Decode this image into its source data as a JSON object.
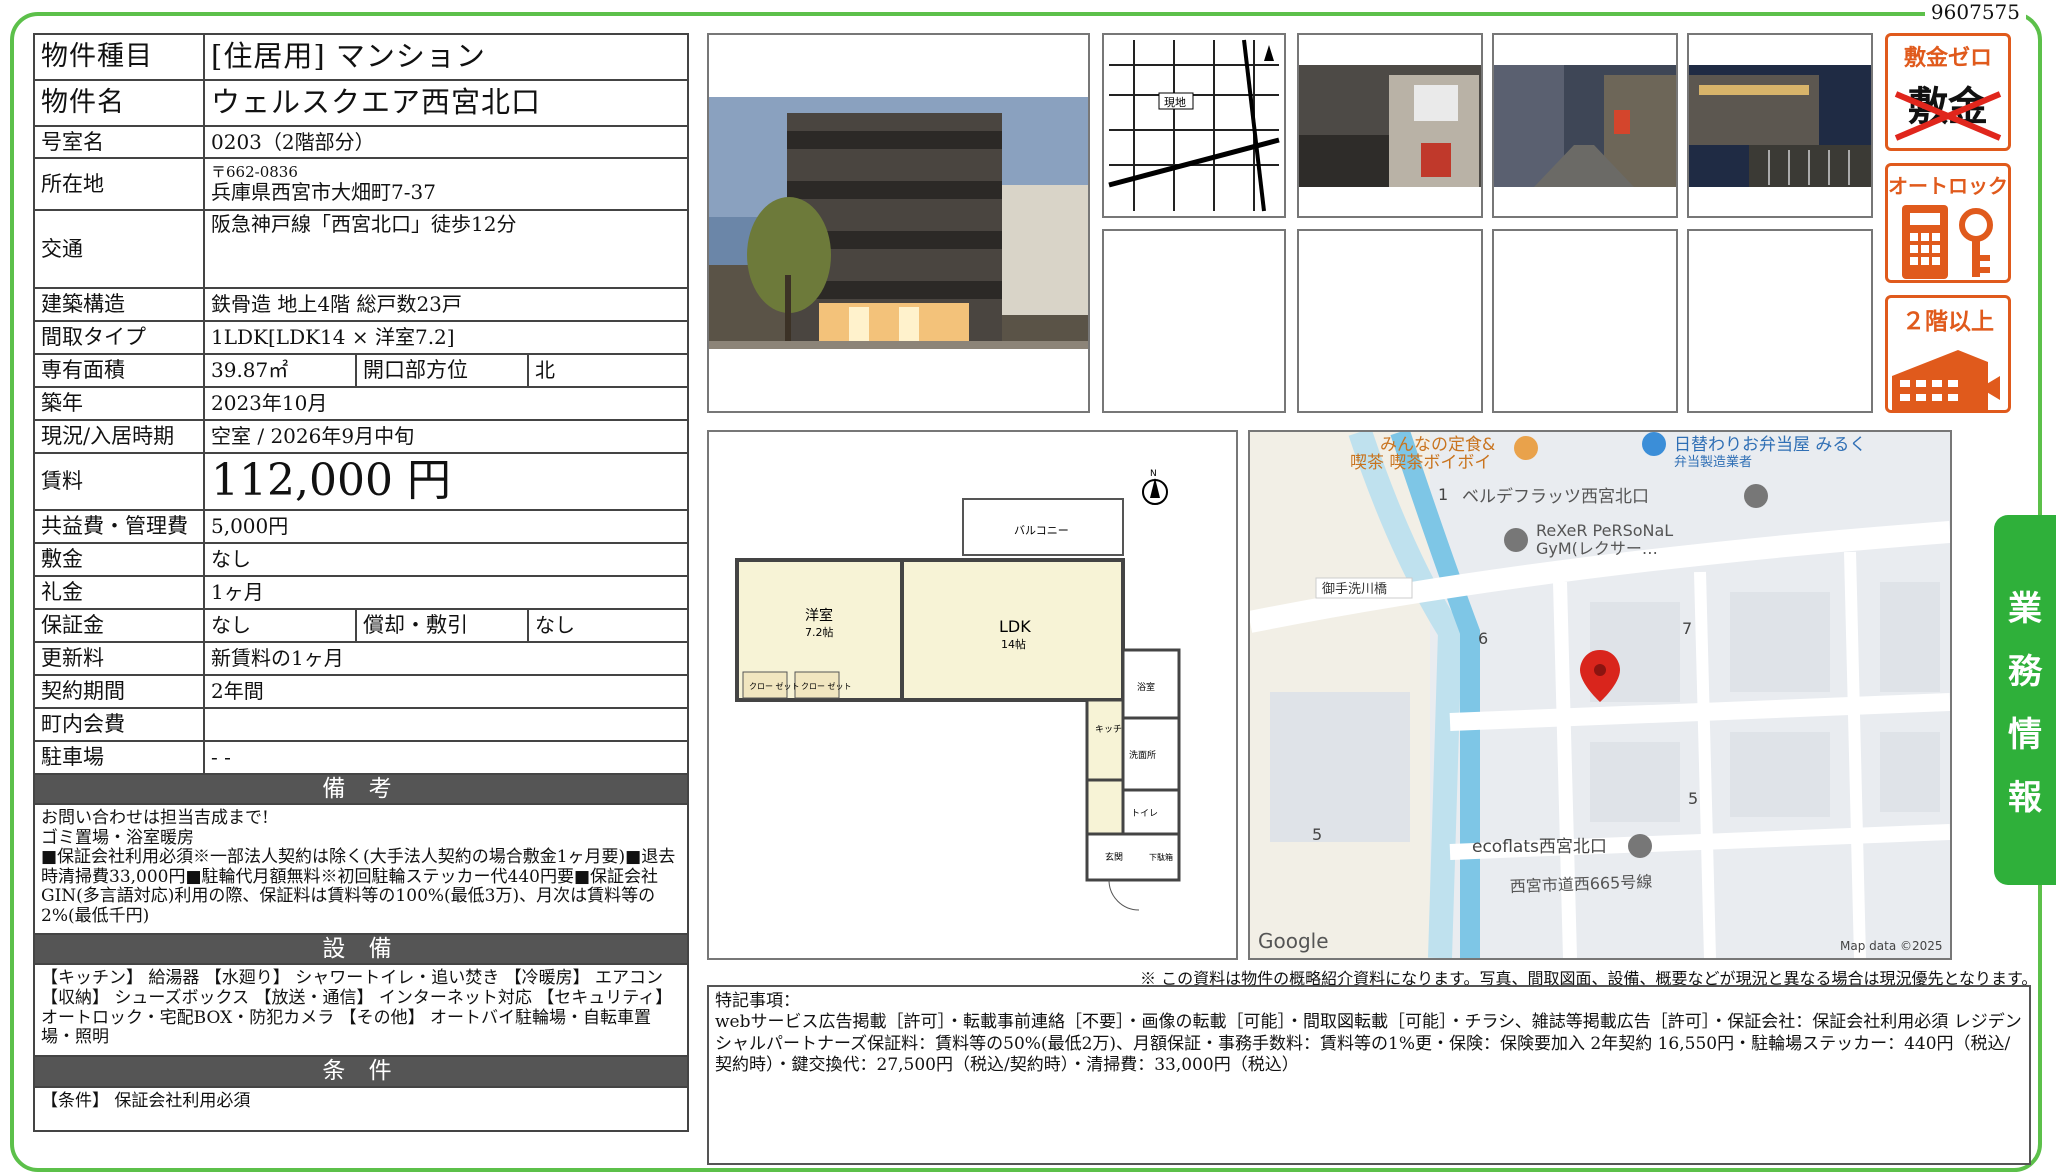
{
  "doc_id": "9607575",
  "table": {
    "kind_label": "物件種目",
    "kind_value": "[住居用] マンション",
    "name_label": "物件名",
    "name_value": "ウェルスクエア西宮北口",
    "room_label": "号室名",
    "room_value": "0203（2階部分）",
    "addr_label": "所在地",
    "zip": "〒662-0836",
    "addr_value": "兵庫県西宮市大畑町7-37",
    "access_label": "交通",
    "access_value": "阪急神戸線「西宮北口」徒歩12分",
    "struct_label": "建築構造",
    "struct_value": "鉄骨造 地上4階 総戸数23戸",
    "layout_label": "間取タイプ",
    "layout_value": "1LDK[LDK14 × 洋室7.2]",
    "area_label": "専有面積",
    "area_value": "39.87㎡",
    "dir_label": "開口部方位",
    "dir_value": "北",
    "built_label": "築年",
    "built_value": "2023年10月",
    "status_label": "現況/入居時期",
    "status_value": "空室 / 2026年9月中旬",
    "rent_label": "賃料",
    "rent_value": "112,000 円",
    "fee_label": "共益費・管理費",
    "fee_value": "5,000円",
    "deposit_label": "敷金",
    "deposit_value": "なし",
    "key_label": "礼金",
    "key_value": "1ヶ月",
    "guar_label": "保証金",
    "guar_value": "なし",
    "amort_label": "償却・敷引",
    "amort_value": "なし",
    "renew_label": "更新料",
    "renew_value": "新賃料の1ヶ月",
    "term_label": "契約期間",
    "term_value": "2年間",
    "town_label": "町内会費",
    "town_value": "",
    "parking_label": "駐車場",
    "parking_value": "- -",
    "notes_header": "備 考",
    "notes": [
      "お問い合わせは担当吉成まで!",
      "ゴミ置場・浴室暖房",
      "■保証会社利用必須※一部法人契約は除く(大手法人契約の場合敷金1ヶ月要)■退去時清掃費33,000円■駐輪代月額無料※初回駐輪ステッカー代440円要■保証会社GIN(多言語対応)利用の際、保証料は賃料等の100%(最低3万)、月次は賃料等の2%(最低千円)"
    ],
    "equip_header": "設 備",
    "equip": "【キッチン】 給湯器 【水廻り】 シャワートイレ・追い焚き 【冷暖房】 エアコン 【収納】 シューズボックス 【放送・通信】 インターネット対応 【セキュリティ】 オートロック・宅配BOX・防犯カメラ 【その他】 オートバイ駐輪場・自転車置場・照明",
    "cond_header": "条 件",
    "cond": "【条件】 保証会社利用必須"
  },
  "icons": {
    "zero_deposit": "敷金ゼロ",
    "zero_deposit_strike": "敷金",
    "autolock": "オートロック",
    "floor2": "２階以上"
  },
  "tab_chars": [
    "業",
    "務",
    "情",
    "報"
  ],
  "floorplan": {
    "balcony": "バルコニー",
    "western": "洋室",
    "western_size": "7.2帖",
    "ldk": "LDK",
    "ldk_size": "14帖",
    "closet": "クロー\nゼット",
    "kitchen": "キッチン",
    "bath": "浴室",
    "wash": "洗面所",
    "toilet": "トイレ",
    "entrance": "玄関",
    "shoe": "下駄箱",
    "north": "N"
  },
  "map": {
    "poi1": "みんなの定食&",
    "poi1b": "喫茶 喫茶ボイボイ",
    "poi2": "日替わりお弁当屋 みるく",
    "poi2b": "弁当製造業者",
    "poi3": "ベルデフラッツ西宮北口",
    "poi4": "ReXeR PeRSoNaL",
    "poi4b": "GyM(レクサー…",
    "bridge": "御手洗川橋",
    "poi5": "ecoflats西宮北口",
    "road": "西宮市道西665号線",
    "n1": "1",
    "n6": "6",
    "n7": "7",
    "n5a": "5",
    "n5b": "5",
    "google": "Google",
    "mapdata": "Map data ©2025"
  },
  "disclaimer": "※ この資料は物件の概略紹介資料になります。写真、間取図面、設備、概要などが現況と異なる場合は現況優先となります。",
  "remarks_title": "特記事項：",
  "remarks": "webサービス広告掲載［許可］・転載事前連絡［不要］・画像の転載［可能］・間取図転載［可能］・チラシ、雑誌等掲載広告［許可］・保証会社：保証会社利用必須 レジデンシャルパートナーズ保証料：賃料等の50%(最低2万)、月額保証・事務手数料：賃料等の1%更・保険：保険要加入 2年契約 16,550円・駐輪場ステッカー：440円（税込/契約時）・鍵交換代：27,500円（税込/契約時）・清掃費：33,000円（税込）"
}
